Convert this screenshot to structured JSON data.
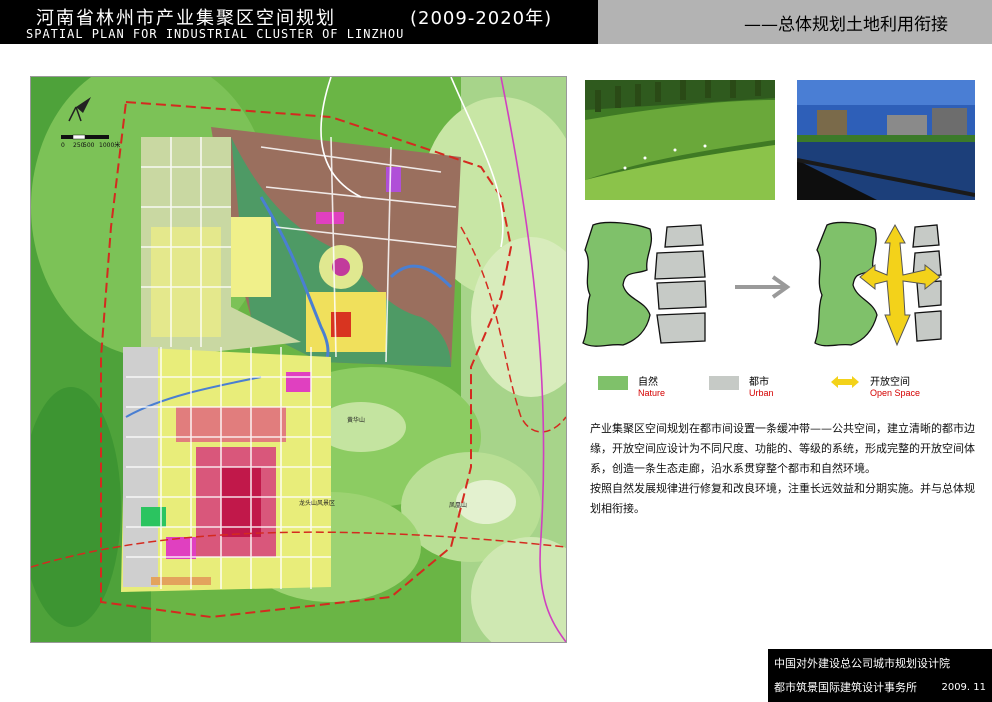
{
  "header": {
    "title": "河南省林州市产业集聚区空间规划",
    "years": "(2009-2020年)",
    "subtitle": "SPATIAL PLAN  FOR INDUSTRIAL CLUSTER OF LINZHOU",
    "section_title": "——总体规划土地利用衔接"
  },
  "map": {
    "scale_labels": [
      "0",
      "250",
      "500",
      "1000米"
    ],
    "place_labels": [
      "黄华山",
      "龙头山风景区",
      "凤凰山"
    ]
  },
  "legend": [
    {
      "zh": "自然",
      "en": "Nature",
      "color": "#7fc16a",
      "icon": "green-swatch"
    },
    {
      "zh": "都市",
      "en": "Urban",
      "color": "#c6cac6",
      "icon": "gray-swatch"
    },
    {
      "zh": "开放空间",
      "en": "Open Space",
      "color": "#f3d21a",
      "icon": "double-arrow-icon"
    }
  ],
  "description": {
    "paragraph1": "产业集聚区空间规划在都市间设置一条缓冲带——公共空间，建立清晰的都市边缘，开放空间应设计为不同尺度、功能的、等级的系统，形成完整的开放空间体系，创造一条生态走廊，沿水系贯穿整个都市和自然环境。",
    "paragraph2": "按照自然发展规律进行修复和改良环境，注重长远效益和分期实施。并与总体规划相衔接。"
  },
  "footer": {
    "line1": "中国对外建设总公司城市规划设计院",
    "line2": "都市筑景国际建筑设计事务所",
    "date": "2009. 11"
  }
}
